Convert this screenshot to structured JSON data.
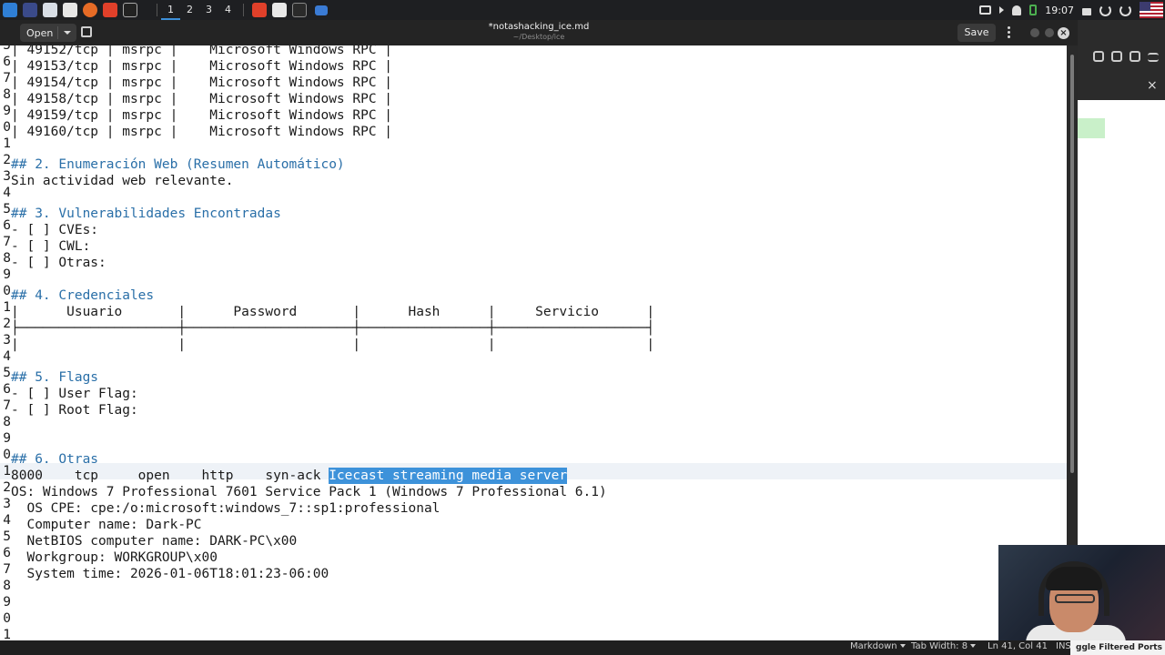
{
  "system_panel": {
    "workspaces": [
      "1",
      "2",
      "3",
      "4"
    ],
    "active_workspace": "1",
    "clock": "19:07",
    "tray_icons": [
      "display-icon",
      "volume-icon",
      "bell-icon",
      "battery-icon",
      "lock-icon",
      "refresh-icon",
      "power-icon",
      "us-flag-icon"
    ]
  },
  "editor_header": {
    "open_label": "Open",
    "title": "*notashacking_ice.md",
    "subtitle": "~/Desktop/ice",
    "save_label": "Save"
  },
  "document": {
    "lines": [
      {
        "n": "5",
        "t": "| 49152/tcp | msrpc |    Microsoft Windows RPC |",
        "kind": "text"
      },
      {
        "n": "6",
        "t": "| 49153/tcp | msrpc |    Microsoft Windows RPC |",
        "kind": "text"
      },
      {
        "n": "7",
        "t": "| 49154/tcp | msrpc |    Microsoft Windows RPC |",
        "kind": "text"
      },
      {
        "n": "8",
        "t": "| 49158/tcp | msrpc |    Microsoft Windows RPC |",
        "kind": "text"
      },
      {
        "n": "9",
        "t": "| 49159/tcp | msrpc |    Microsoft Windows RPC |",
        "kind": "text"
      },
      {
        "n": "0",
        "t": "| 49160/tcp | msrpc |    Microsoft Windows RPC |",
        "kind": "text"
      },
      {
        "n": "1",
        "t": "",
        "kind": "text"
      },
      {
        "n": "2",
        "t": "## 2. Enumeración Web (Resumen Automático)",
        "kind": "heading"
      },
      {
        "n": "3",
        "t": "Sin actividad web relevante.",
        "kind": "text"
      },
      {
        "n": "4",
        "t": "",
        "kind": "text"
      },
      {
        "n": "5",
        "t": "## 3. Vulnerabilidades Encontradas",
        "kind": "heading"
      },
      {
        "n": "6",
        "t": "- [ ] CVEs:",
        "kind": "text"
      },
      {
        "n": "7",
        "t": "- [ ] CWL:",
        "kind": "text"
      },
      {
        "n": "8",
        "t": "- [ ] Otras:",
        "kind": "text"
      },
      {
        "n": "9",
        "t": "",
        "kind": "text"
      },
      {
        "n": "0",
        "t": "## 4. Credenciales",
        "kind": "heading"
      },
      {
        "n": "1",
        "t": "|      Usuario       |      Password       |      Hash      |     Servicio      |",
        "kind": "text"
      },
      {
        "n": "2",
        "t": "├────────────────────┼─────────────────────┼────────────────┼───────────────────┤",
        "kind": "text"
      },
      {
        "n": "3",
        "t": "|                    |                     |                |                   |",
        "kind": "text"
      },
      {
        "n": "4",
        "t": "",
        "kind": "text"
      },
      {
        "n": "5",
        "t": "## 5. Flags",
        "kind": "heading"
      },
      {
        "n": "6",
        "t": "- [ ] User Flag:",
        "kind": "text"
      },
      {
        "n": "7",
        "t": "- [ ] Root Flag:",
        "kind": "text"
      },
      {
        "n": "8",
        "t": "",
        "kind": "text"
      },
      {
        "n": "9",
        "t": "",
        "kind": "text"
      },
      {
        "n": "0",
        "t": "## 6. Otras",
        "kind": "heading"
      },
      {
        "n": "1",
        "t": "8000    tcp     open    http    syn-ack ",
        "sel": "Icecast streaming media server",
        "kind": "current"
      },
      {
        "n": "2",
        "t": "OS: Windows 7 Professional 7601 Service Pack 1 (Windows 7 Professional 6.1)",
        "kind": "text"
      },
      {
        "n": "3",
        "t": "  OS CPE: cpe:/o:microsoft:windows_7::sp1:professional",
        "kind": "text"
      },
      {
        "n": "4",
        "t": "  Computer name: Dark-PC",
        "kind": "text"
      },
      {
        "n": "5",
        "t": "  NetBIOS computer name: DARK-PC\\x00",
        "kind": "text"
      },
      {
        "n": "6",
        "t": "  Workgroup: WORKGROUP\\x00",
        "kind": "text"
      },
      {
        "n": "7",
        "t": "  System time: 2026-01-06T18:01:23-06:00",
        "kind": "text"
      },
      {
        "n": "8",
        "t": "",
        "kind": "text"
      },
      {
        "n": "9",
        "t": "",
        "kind": "text"
      },
      {
        "n": "0",
        "t": "",
        "kind": "text"
      },
      {
        "n": "1",
        "t": "",
        "kind": "text"
      }
    ]
  },
  "status_bar": {
    "language": "Markdown",
    "tab_width": "Tab Width: 8",
    "position": "Ln 41, Col 41",
    "mode": "INS",
    "overlay_text": "ggle Filtered Ports"
  },
  "colors": {
    "heading": "#2a6fa8",
    "selection": "#3d92da",
    "panel": "#1e1f22"
  }
}
